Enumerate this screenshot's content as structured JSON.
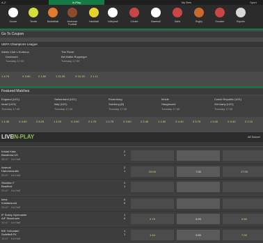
{
  "topbar": {
    "left_label": "A-Z",
    "active_tab": "In-Play",
    "middle_tab": "My Bets",
    "right_label": "Sport"
  },
  "sports": [
    {
      "label": "Soccer",
      "icon": "soccer-ball-icon",
      "color": "#ffffff"
    },
    {
      "label": "Tennis",
      "icon": "tennis-ball-icon",
      "color": "#d4e03a"
    },
    {
      "label": "Basketball",
      "icon": "basketball-icon",
      "color": "#e07a2c"
    },
    {
      "label": "American Football",
      "icon": "american-football-icon",
      "color": "#8a4b2a"
    },
    {
      "label": "Handball",
      "icon": "handball-icon",
      "color": "#e6d22c"
    },
    {
      "label": "Volleyball",
      "icon": "volleyball-icon",
      "color": "#ffffff"
    },
    {
      "label": "Cricket",
      "icon": "cricket-icon",
      "color": "#c94646"
    },
    {
      "label": "Baseball",
      "icon": "baseball-icon",
      "color": "#ffffff"
    },
    {
      "label": "Darts",
      "icon": "darts-icon",
      "color": "#c94646"
    },
    {
      "label": "Rugby",
      "icon": "rugby-ball-icon",
      "color": "#c96a2c"
    },
    {
      "label": "Snooker",
      "icon": "snooker-icon",
      "color": "#c94646"
    },
    {
      "label": "Esports",
      "icon": "esports-icon",
      "color": "#d8d8d8"
    }
  ],
  "go_to_coupon": "Go To Coupon",
  "ucl": {
    "title": "UEFA Champions League",
    "team_a1": "Atletic Club v Dortmun",
    "team_a2": "Dortmund",
    "team_b1": "The Rover",
    "team_b2": "Bet Battle Ruppeiger",
    "time_a": "Tuesday 17:00",
    "time_b": "Tuesday 17:00",
    "odds": [
      "1 4.75",
      "X 3.60",
      "2 1.50",
      "1 21.25",
      "X 10.20",
      "2 1.11"
    ]
  },
  "featured": {
    "title": "Featured Matches",
    "matches": [
      {
        "t1": "England (U21)",
        "t2": "Israel (U21)",
        "time": "Tuesday 17:45"
      },
      {
        "t1": "Switzerland (U21)",
        "t2": "Italy (U21)",
        "time": "Tuesday 17:45"
      },
      {
        "t1": "Rosenborg",
        "t2": "Salzburg (B)",
        "time": "Tuesday 17:45"
      },
      {
        "t1": "Molde",
        "t2": "Haugesund",
        "time": "Tuesday 17:45"
      },
      {
        "t1": "Czech Republic (U21)",
        "t2": "Germany (U21)",
        "time": "Tuesday 17:45"
      }
    ],
    "odds": [
      "1 1.36",
      "X 4.60",
      "2 8.25",
      "1 4.20",
      "X 4.00",
      "2 1.75",
      "1 2.75",
      "X 3.60",
      "2 2.45",
      "1 1.50",
      "X 4.40",
      "2 5.75",
      "1 3.40",
      "X 3.40",
      "2 2.10"
    ]
  },
  "live": {
    "title": "LIVE",
    "subtitle": "IN-PLAY",
    "right_label": "All Soccer",
    "matches": [
      {
        "t1": "Kristal Kata",
        "t2": "Bandirma US",
        "meta": "35:47 · 1st Half",
        "s1": "2",
        "s2": "1",
        "o1": "",
        "o2": "",
        "o3": ""
      },
      {
        "t1": "Arsenal",
        "t2": "Hammersmith",
        "meta": "30:47 · 1st Half",
        "s1": "2",
        "s2": "1",
        "o1": "29.00",
        "o2": "7.00",
        "o3": "17.00"
      },
      {
        "t1": "Stockton T",
        "t2": "Bradford",
        "meta": "20:47 · 1st Half",
        "s1": "2",
        "s2": "1",
        "o1": "",
        "o2": "",
        "o3": ""
      },
      {
        "t1": "Metz",
        "t2": "Kristiansund",
        "meta": "25:47 · 1st Half",
        "s1": "0",
        "s2": "0",
        "o1": "",
        "o2": "",
        "o3": ""
      },
      {
        "t1": "IF Sosby Gymnaster",
        "t2": "AIF Stockholm",
        "meta": "10:47 · 1st Half",
        "s1": "1",
        "s2": "0",
        "o1": "2.75",
        "o2": "3.25",
        "o3": "2.50"
      },
      {
        "t1": "BIK Yxhunden",
        "t2": "Sollefteå FK",
        "meta": "15:47 · 1st Half",
        "s1": "1",
        "s2": "1",
        "o1": "1.44",
        "o2": "3.50",
        "o3": "7.00"
      }
    ]
  }
}
